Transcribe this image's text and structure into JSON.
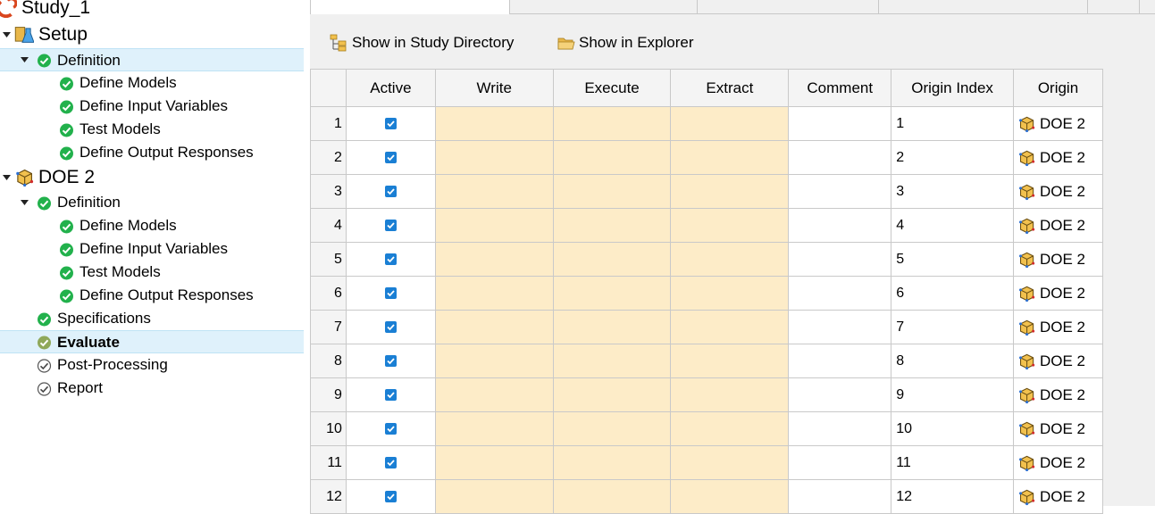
{
  "tree": {
    "nodes": [
      {
        "label": "Study_1",
        "indent": 0,
        "icon": "study-icon",
        "twisty": "none",
        "big": true
      },
      {
        "label": "Setup",
        "indent": 0,
        "icon": "setup-flask-icon",
        "twisty": "expanded",
        "big": true
      },
      {
        "label": "Definition",
        "indent": 1,
        "icon": "check-green-icon",
        "twisty": "expanded",
        "selected": true
      },
      {
        "label": "Define Models",
        "indent": 2,
        "icon": "check-green-icon",
        "twisty": "none"
      },
      {
        "label": "Define Input Variables",
        "indent": 2,
        "icon": "check-green-icon",
        "twisty": "none"
      },
      {
        "label": "Test Models",
        "indent": 2,
        "icon": "check-green-icon",
        "twisty": "none"
      },
      {
        "label": "Define Output Responses",
        "indent": 2,
        "icon": "check-green-icon",
        "twisty": "none"
      },
      {
        "label": "DOE 2",
        "indent": 0,
        "icon": "doe-cube-icon",
        "twisty": "expanded",
        "big": true
      },
      {
        "label": "Definition",
        "indent": 1,
        "icon": "check-green-icon",
        "twisty": "expanded"
      },
      {
        "label": "Define Models",
        "indent": 2,
        "icon": "check-green-icon",
        "twisty": "none"
      },
      {
        "label": "Define Input Variables",
        "indent": 2,
        "icon": "check-green-icon",
        "twisty": "none"
      },
      {
        "label": "Test Models",
        "indent": 2,
        "icon": "check-green-icon",
        "twisty": "none"
      },
      {
        "label": "Define Output Responses",
        "indent": 2,
        "icon": "check-green-icon",
        "twisty": "none"
      },
      {
        "label": "Specifications",
        "indent": 1,
        "icon": "check-green-icon",
        "twisty": "none"
      },
      {
        "label": "Evaluate",
        "indent": 1,
        "icon": "check-olive-icon",
        "twisty": "none",
        "selected": true,
        "bold": true
      },
      {
        "label": "Post-Processing",
        "indent": 1,
        "icon": "check-outline-icon",
        "twisty": "none"
      },
      {
        "label": "Report",
        "indent": 1,
        "icon": "check-outline-icon",
        "twisty": "none"
      }
    ]
  },
  "toolbar": {
    "show_study_dir": "Show in Study Directory",
    "show_explorer": "Show in Explorer"
  },
  "table": {
    "columns": [
      "",
      "Active",
      "Write",
      "Execute",
      "Extract",
      "Comment",
      "Origin Index",
      "Origin"
    ],
    "rows": [
      {
        "n": "1",
        "active": true,
        "origin_index": "1",
        "origin": "DOE 2"
      },
      {
        "n": "2",
        "active": true,
        "origin_index": "2",
        "origin": "DOE 2"
      },
      {
        "n": "3",
        "active": true,
        "origin_index": "3",
        "origin": "DOE 2"
      },
      {
        "n": "4",
        "active": true,
        "origin_index": "4",
        "origin": "DOE 2"
      },
      {
        "n": "5",
        "active": true,
        "origin_index": "5",
        "origin": "DOE 2"
      },
      {
        "n": "6",
        "active": true,
        "origin_index": "6",
        "origin": "DOE 2"
      },
      {
        "n": "7",
        "active": true,
        "origin_index": "7",
        "origin": "DOE 2"
      },
      {
        "n": "8",
        "active": true,
        "origin_index": "8",
        "origin": "DOE 2"
      },
      {
        "n": "9",
        "active": true,
        "origin_index": "9",
        "origin": "DOE 2"
      },
      {
        "n": "10",
        "active": true,
        "origin_index": "10",
        "origin": "DOE 2"
      },
      {
        "n": "11",
        "active": true,
        "origin_index": "11",
        "origin": "DOE 2"
      },
      {
        "n": "12",
        "active": true,
        "origin_index": "12",
        "origin": "DOE 2"
      }
    ]
  },
  "colors": {
    "selection": "#dff1fb",
    "check_green": "#22b14c",
    "check_olive": "#8fa85a",
    "cell_highlight": "#fdecc8",
    "checkbox": "#1a7fd4"
  }
}
